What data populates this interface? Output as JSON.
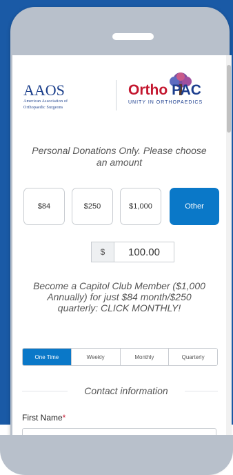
{
  "branding": {
    "aaos_logo": "AAOS",
    "aaos_subtitle_line1": "American Association of",
    "aaos_subtitle_line2": "Orthopaedic Surgeons",
    "orthopac_logo_ortho": "Ortho",
    "orthopac_logo_pac": "PAC",
    "orthopac_tagline": "UNITY IN ORTHOPAEDICS"
  },
  "donation": {
    "prompt": "Personal Donations Only. Please choose an amount",
    "amount_options": [
      "$84",
      "$250",
      "$1,000",
      "Other"
    ],
    "selected_option": "Other",
    "currency_symbol": "$",
    "amount_value": "100.00",
    "capitol_club_text": "Become a Capitol Club Member ($1,000 Annually) for just $84 month/$250 quarterly: CLICK MONTHLY!"
  },
  "frequency": {
    "tabs": [
      "One Time",
      "Weekly",
      "Monthly",
      "Quarterly"
    ],
    "selected": "One Time"
  },
  "contact": {
    "heading": "Contact information",
    "first_name_label": "First Name",
    "required_marker": "*",
    "first_name_value": ""
  },
  "colors": {
    "page_background": "#1a5aa6",
    "phone_frame": "#b8c0cb",
    "accent": "#0a78c8",
    "ortho_red": "#c4172f",
    "brand_blue": "#1c3e8e"
  }
}
